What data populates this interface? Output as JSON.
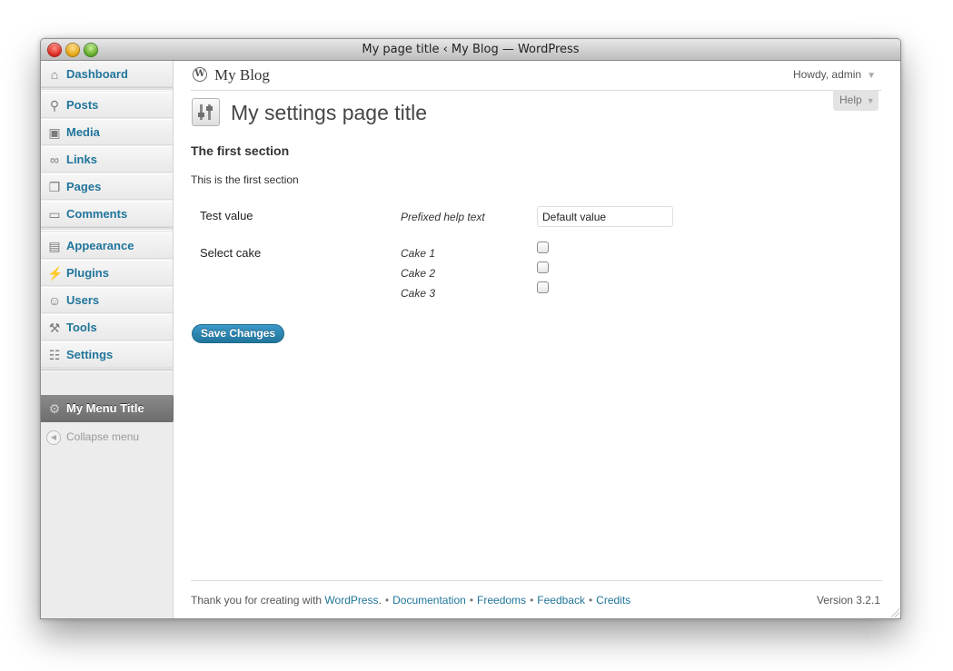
{
  "window": {
    "title": "My page title ‹ My Blog — WordPress"
  },
  "sidebar": {
    "items": [
      {
        "label": "Dashboard",
        "icon": "house-icon"
      },
      {
        "label": "Posts",
        "icon": "pushpin-icon"
      },
      {
        "label": "Media",
        "icon": "media-icon"
      },
      {
        "label": "Links",
        "icon": "link-icon"
      },
      {
        "label": "Pages",
        "icon": "pages-icon"
      },
      {
        "label": "Comments",
        "icon": "comment-icon"
      },
      {
        "label": "Appearance",
        "icon": "appearance-icon"
      },
      {
        "label": "Plugins",
        "icon": "plug-icon"
      },
      {
        "label": "Users",
        "icon": "users-icon"
      },
      {
        "label": "Tools",
        "icon": "tools-icon"
      },
      {
        "label": "Settings",
        "icon": "settings-icon"
      }
    ],
    "current": {
      "label": "My Menu Title",
      "icon": "gear-icon"
    },
    "collapse_label": "Collapse menu"
  },
  "header": {
    "blog_name": "My Blog",
    "howdy": "Howdy, admin",
    "help_label": "Help"
  },
  "page": {
    "title": "My settings page title",
    "section_title": "The first section",
    "section_description": "This is the first section",
    "fields": {
      "test_value": {
        "label": "Test value",
        "help": "Prefixed help text",
        "value": "Default value"
      },
      "select_cake": {
        "label": "Select cake",
        "options": [
          {
            "label": "Cake 1",
            "checked": false
          },
          {
            "label": "Cake 2",
            "checked": false
          },
          {
            "label": "Cake 3",
            "checked": false
          }
        ]
      }
    },
    "save_label": "Save Changes"
  },
  "footer": {
    "thanks_prefix": "Thank you for creating with",
    "wordpress_link": "WordPress",
    "links": [
      "Documentation",
      "Freedoms",
      "Feedback",
      "Credits"
    ],
    "version": "Version 3.2.1"
  },
  "colors": {
    "link": "#21759b",
    "current_menu_bg": "#7a7a7a",
    "button_bg": "#21759b"
  }
}
